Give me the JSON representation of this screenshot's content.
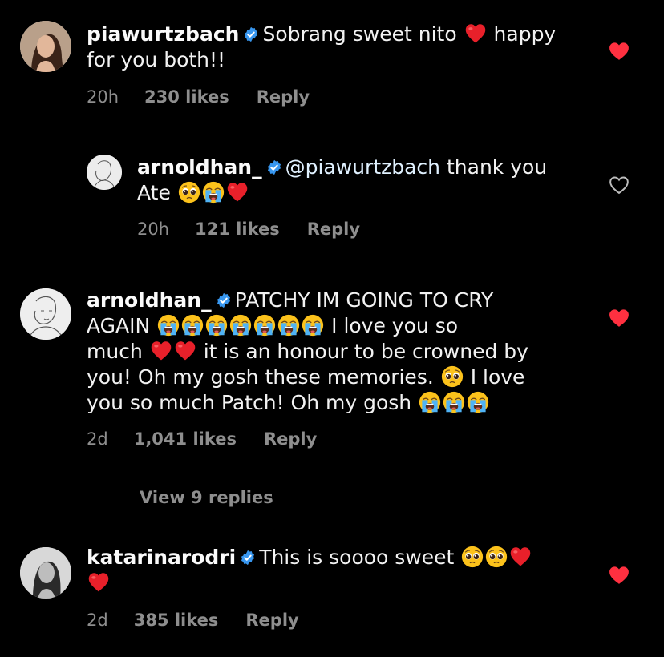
{
  "comments": [
    {
      "username": "piawurtzbach",
      "text_line1_a": "Sobrang sweet nito",
      "text_line1_b": "happy",
      "text_line2": "for you both!!",
      "time": "20h",
      "likes": "230 likes",
      "reply": "Reply",
      "liked": true
    },
    {
      "username": "arnoldhan_",
      "mention": "@piawurtzbach",
      "text_line1": "thank you",
      "text_line2": "Ate",
      "time": "20h",
      "likes": "121 likes",
      "reply": "Reply",
      "liked": false
    },
    {
      "username": "arnoldhan_",
      "text_line1": "PATCHY IM GOING TO CRY",
      "text_line2_a": "AGAIN",
      "text_line2_b": "I love you so",
      "text_line3_a": "much",
      "text_line3_b": "it is an honour to be crowned by",
      "text_line4_a": "you! Oh my gosh these memories.",
      "text_line4_b": "I love",
      "text_line5": "you so much Patch! Oh my gosh",
      "time": "2d",
      "likes": "1,041 likes",
      "reply": "Reply",
      "liked": true
    },
    {
      "username": "katarinarodri",
      "text_line1": "This is soooo sweet",
      "time": "2d",
      "likes": "385 likes",
      "reply": "Reply",
      "liked": true
    }
  ],
  "view_replies": "View 9 replies",
  "colors": {
    "background": "#000000",
    "text": "#f2f2f2",
    "meta": "#8e8e8e",
    "heart_liked": "#ff3040",
    "verified": "#3897f0"
  }
}
